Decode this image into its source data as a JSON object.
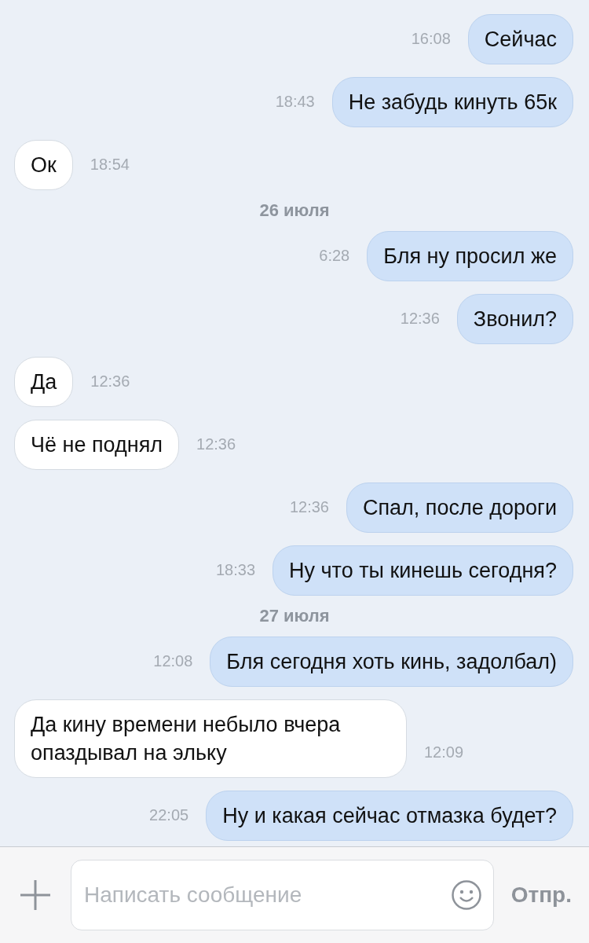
{
  "messages": [
    {
      "kind": "message",
      "outgoing": true,
      "text": "Сейчас",
      "time": "16:08"
    },
    {
      "kind": "message",
      "outgoing": true,
      "text": "Не забудь кинуть 65к",
      "time": "18:43"
    },
    {
      "kind": "message",
      "outgoing": false,
      "text": "Ок",
      "time": "18:54"
    },
    {
      "kind": "date",
      "text": "26 июля"
    },
    {
      "kind": "message",
      "outgoing": true,
      "text": "Бля ну просил же",
      "time": "6:28"
    },
    {
      "kind": "message",
      "outgoing": true,
      "text": "Звонил?",
      "time": "12:36"
    },
    {
      "kind": "message",
      "outgoing": false,
      "text": "Да",
      "time": "12:36"
    },
    {
      "kind": "message",
      "outgoing": false,
      "text": "Чё не поднял",
      "time": "12:36"
    },
    {
      "kind": "message",
      "outgoing": true,
      "text": "Спал, после дороги",
      "time": "12:36"
    },
    {
      "kind": "message",
      "outgoing": true,
      "text": "Ну что ты кинешь сегодня?",
      "time": "18:33"
    },
    {
      "kind": "date",
      "text": "27 июля"
    },
    {
      "kind": "message",
      "outgoing": true,
      "text": "Бля сегодня хоть кинь, задолбал)",
      "time": "12:08"
    },
    {
      "kind": "message",
      "outgoing": false,
      "text": "Да кину времени небыло вчера опаздывал на эльку",
      "time": "12:09"
    },
    {
      "kind": "message",
      "outgoing": true,
      "text": "Ну и какая сейчас отмазка будет?",
      "time": "22:05"
    }
  ],
  "composer": {
    "placeholder": "Написать сообщение",
    "send": "Отпр."
  }
}
